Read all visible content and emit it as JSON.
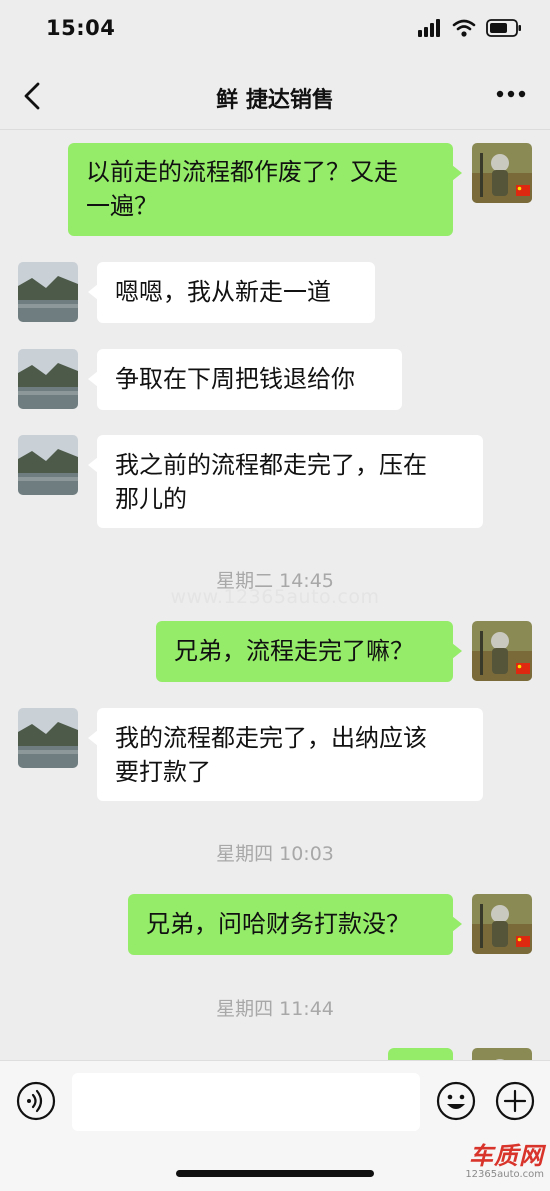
{
  "status_bar": {
    "time": "15:04"
  },
  "header": {
    "title": "鲜 捷达销售"
  },
  "messages": [
    {
      "side": "self",
      "line1": "以前走的流程都作废了？又走",
      "line2": "一遍？"
    },
    {
      "side": "other",
      "line1": "嗯嗯，我从新走一道"
    },
    {
      "side": "other",
      "line1": "争取在下周把钱退给你"
    },
    {
      "side": "other",
      "line1": "我之前的流程都走完了，压在",
      "line2": "那儿的"
    },
    {
      "side": "self",
      "line1": "兄弟，流程走完了嘛？"
    },
    {
      "side": "other",
      "line1": "我的流程都走完了，出纳应该",
      "line2": "要打款了"
    },
    {
      "side": "self",
      "line1": "兄弟，问哈财务打款没？"
    }
  ],
  "timestamps": [
    "星期二 14:45",
    "星期四 10:03",
    "星期四 11:44"
  ],
  "watermark_text": "www.12365auto.com",
  "input": {
    "value": "",
    "placeholder": ""
  },
  "icons": {
    "back": "chevron-left-icon",
    "more": "more-dots-icon",
    "voice": "voice-icon",
    "emoji": "emoji-icon",
    "plus": "plus-icon"
  },
  "logo": {
    "main": "车质网",
    "sub": "12365auto.com"
  },
  "colors": {
    "background": "#ededed",
    "self_bubble": "#95ec69",
    "other_bubble": "#ffffff",
    "timestamp": "#a8a8a8",
    "logo": "#d9342b"
  }
}
